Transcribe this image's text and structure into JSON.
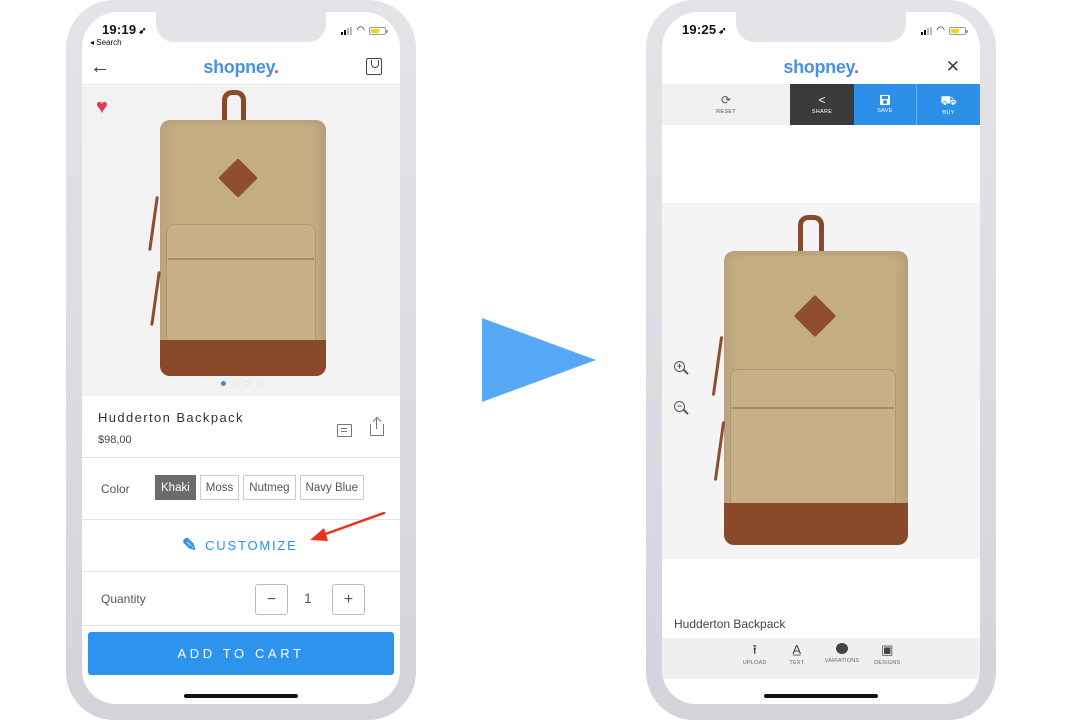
{
  "flow_arrow": {
    "color": "#58a8f8"
  },
  "left_screen": {
    "status": {
      "time": "19:19",
      "location_glyph": "➶",
      "back_app": "◂ Search"
    },
    "nav": {
      "logo": "shopney",
      "logo_dot": ".",
      "back_icon": "←"
    },
    "product": {
      "favorite_icon": "♥",
      "image_pages": 4,
      "active_page": 1,
      "name": "Hudderton Backpack",
      "price": "$98,00"
    },
    "color": {
      "label": "Color",
      "options": [
        "Khaki",
        "Moss",
        "Nutmeg",
        "Navy Blue"
      ],
      "selected": "Khaki"
    },
    "customize": {
      "icon": "✎",
      "label": "CUSTOMIZE"
    },
    "quantity": {
      "label": "Quantity",
      "minus": "−",
      "plus": "+",
      "value": "1"
    },
    "add_to_cart": "ADD TO CART"
  },
  "right_screen": {
    "status": {
      "time": "19:25",
      "location_glyph": "➶"
    },
    "nav": {
      "logo": "shopney",
      "logo_dot": ".",
      "close_icon": "✕"
    },
    "toolbar": [
      {
        "label": "RESET",
        "icon": "⟳"
      },
      {
        "label": "SHARE",
        "icon": "<"
      },
      {
        "label": "SAVE",
        "icon": "💾"
      },
      {
        "label": "BUY",
        "icon": "🛒"
      }
    ],
    "zoom_in": "+",
    "zoom_out": "−",
    "design_name": "Hudderton Backpack",
    "bottom_bar": [
      {
        "label": "UPLOAD",
        "icon": "⭱"
      },
      {
        "label": "TEXT",
        "icon": "A̲"
      },
      {
        "label": "VARIATIONS",
        "icon": "🎨"
      },
      {
        "label": "DESIGNS",
        "icon": "▣"
      }
    ]
  },
  "colors": {
    "brand": "#4a90e2",
    "accent": "#2d94ee",
    "share_bg": "#3b3b3b",
    "favorite": "#e03a52",
    "annotation_arrow": "#e8321e"
  }
}
